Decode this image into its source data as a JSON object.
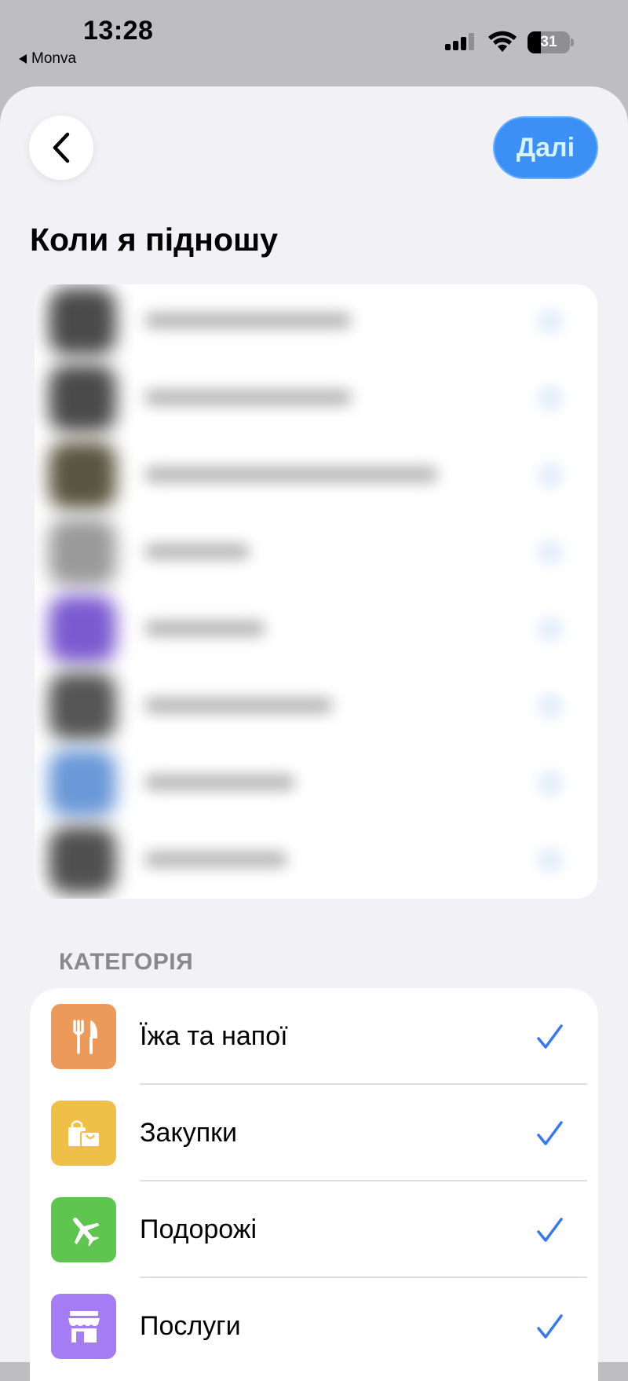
{
  "status_bar": {
    "time": "13:28",
    "back_app": "Monva",
    "battery": "31"
  },
  "header": {
    "title": "Коли я підношу",
    "next_label": "Далі"
  },
  "merchants": [
    {
      "icon_color": "#4a4a4a",
      "bar_width_fraction": 0.55
    },
    {
      "icon_color": "#4a4a4a",
      "bar_width_fraction": 0.55
    },
    {
      "icon_color": "#5a5540",
      "bar_width_fraction": 0.78
    },
    {
      "icon_color": "#9a9a9a",
      "bar_width_fraction": 0.28
    },
    {
      "icon_color": "#7b5ad0",
      "bar_width_fraction": 0.32
    },
    {
      "icon_color": "#555555",
      "bar_width_fraction": 0.5
    },
    {
      "icon_color": "#6a98d8",
      "bar_width_fraction": 0.4
    },
    {
      "icon_color": "#505050",
      "bar_width_fraction": 0.38
    }
  ],
  "category_section": {
    "label": "КАТЕГОРІЯ",
    "items": [
      {
        "label": "Їжа та напої",
        "icon": "fork-knife-icon",
        "color": "#ec9a5a",
        "checked": true
      },
      {
        "label": "Закупки",
        "icon": "shopping-bags-icon",
        "color": "#efbf47",
        "checked": true
      },
      {
        "label": "Подорожі",
        "icon": "airplane-icon",
        "color": "#5ec54f",
        "checked": true
      },
      {
        "label": "Послуги",
        "icon": "storefront-icon",
        "color": "#a47cf3",
        "checked": true
      }
    ]
  },
  "colors": {
    "accent": "#3b8ff5",
    "check": "#3478f6",
    "background": "#f2f1f6"
  }
}
